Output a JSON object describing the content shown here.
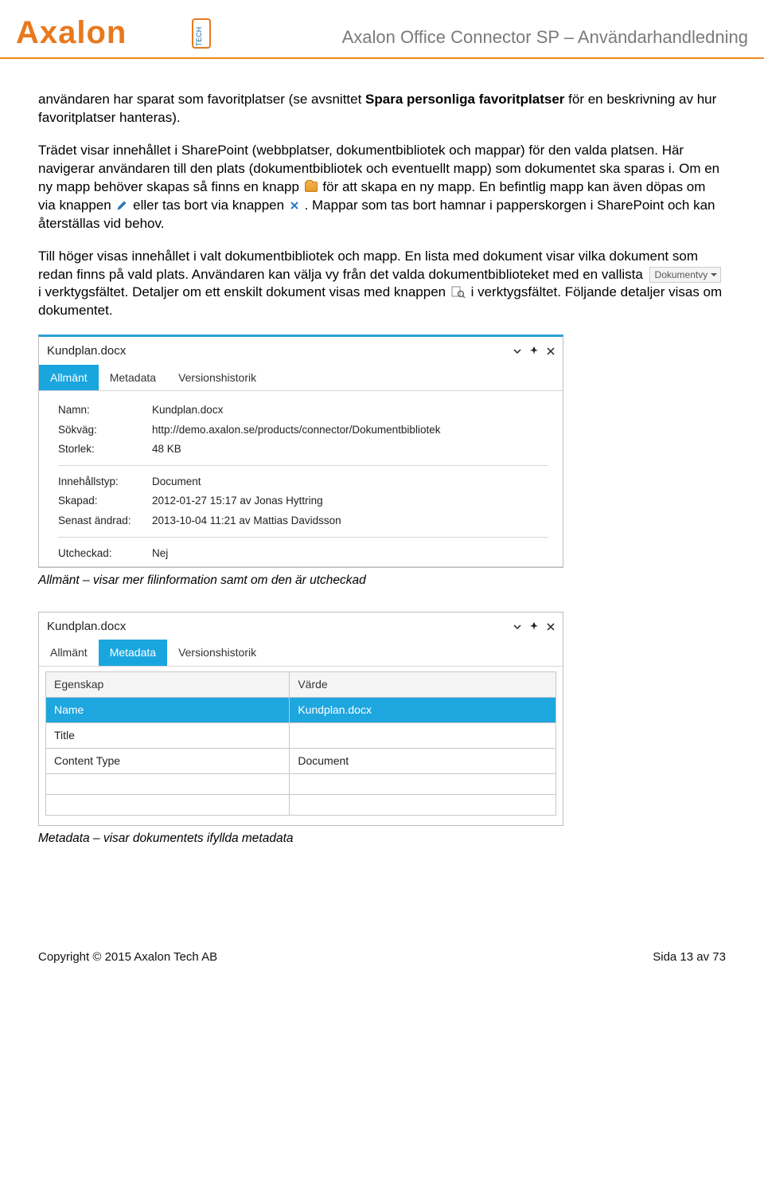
{
  "header": {
    "doc_title": "Axalon Office Connector SP – Användarhandledning"
  },
  "body": {
    "p1_a": "användaren har sparat som favoritplatser (se avsnittet ",
    "p1_b": "Spara personliga favoritplatser",
    "p1_c": " för en beskrivning av hur favoritplatser hanteras).",
    "p2_a": "Trädet visar innehållet i SharePoint (webbplatser, dokumentbibliotek och mappar) för den valda platsen. Här navigerar användaren till den plats (dokumentbibliotek och eventuellt mapp) som dokumentet ska sparas i. Om en ny mapp behöver skapas så finns en knapp ",
    "p2_b": " för att skapa en ny mapp. En befintlig mapp kan även döpas om via knappen ",
    "p2_c": " eller tas bort via knappen ",
    "p2_d": ". Mappar som tas bort hamnar i papperskorgen i SharePoint och kan återställas vid behov.",
    "p3_a": "Till höger visas innehållet i valt dokumentbibliotek och mapp. En lista med dokument visar vilka dokument som redan finns på vald plats. Användaren kan välja vy från det valda dokumentbiblioteket med en vallista ",
    "p3_chip": "Dokumentvy",
    "p3_b": " i verktygsfältet.  Detaljer om ett enskilt dokument visas med knappen ",
    "p3_c": " i verktygsfältet. Följande detaljer visas om dokumentet."
  },
  "panel1": {
    "title": "Kundplan.docx",
    "tabs": {
      "t1": "Allmänt",
      "t2": "Metadata",
      "t3": "Versionshistorik"
    },
    "rows": {
      "name_l": "Namn:",
      "name_v": "Kundplan.docx",
      "path_l": "Sökväg:",
      "path_v": "http://demo.axalon.se/products/connector/Dokumentbibliotek",
      "size_l": "Storlek:",
      "size_v": "48 KB",
      "ctype_l": "Innehållstyp:",
      "ctype_v": "Document",
      "created_l": "Skapad:",
      "created_v": "2012-01-27 15:17 av Jonas Hyttring",
      "modified_l": "Senast ändrad:",
      "modified_v": "2013-10-04 11:21 av Mattias Davidsson",
      "checked_l": "Utcheckad:",
      "checked_v": "Nej"
    },
    "caption": "Allmänt – visar mer filinformation samt om den är utcheckad"
  },
  "panel2": {
    "title": "Kundplan.docx",
    "tabs": {
      "t1": "Allmänt",
      "t2": "Metadata",
      "t3": "Versionshistorik"
    },
    "grid": {
      "h1": "Egenskap",
      "h2": "Värde",
      "r1c1": "Name",
      "r1c2": "Kundplan.docx",
      "r2c1": "Title",
      "r2c2": "",
      "r3c1": "Content Type",
      "r3c2": "Document"
    },
    "caption": "Metadata – visar dokumentets ifyllda metadata"
  },
  "footer": {
    "left": "Copyright © 2015 Axalon Tech AB",
    "right": "Sida 13 av 73"
  }
}
